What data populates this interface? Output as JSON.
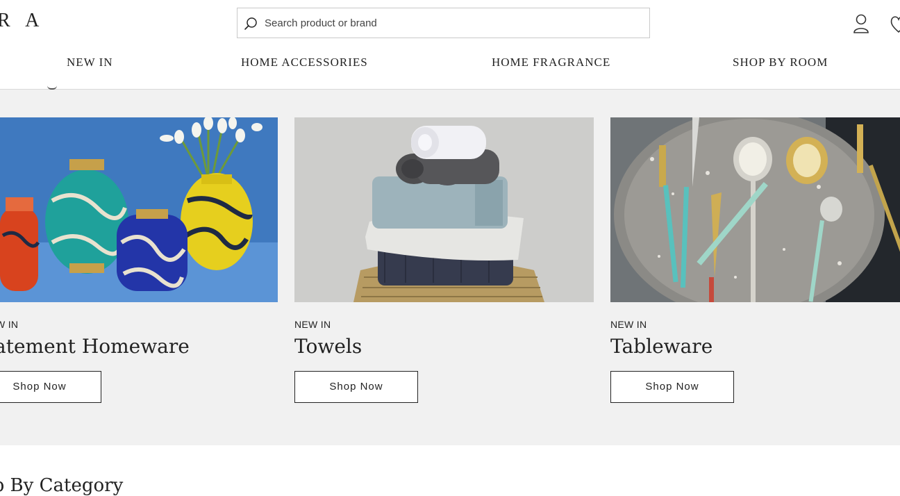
{
  "header": {
    "logo_text": "R A",
    "search_placeholder": "Search product or brand",
    "nav": [
      "NEW IN",
      "HOME ACCESSORIES",
      "HOME FRAGRANCE",
      "SHOP BY ROOM"
    ]
  },
  "promo": {
    "cards": [
      {
        "kicker": "W IN",
        "title": "atement Homeware",
        "button": "Shop Now",
        "image": "colorful-vases-with-tulips"
      },
      {
        "kicker": "NEW IN",
        "title": "Towels",
        "button": "Shop Now",
        "image": "stacked-towels"
      },
      {
        "kicker": "NEW IN",
        "title": "Tableware",
        "button": "Shop Now",
        "image": "gold-cutlery-on-plate"
      }
    ]
  },
  "section": {
    "title": "op By Category"
  },
  "colors": {
    "band_bg": "#f1f1f1",
    "border": "#222222"
  }
}
